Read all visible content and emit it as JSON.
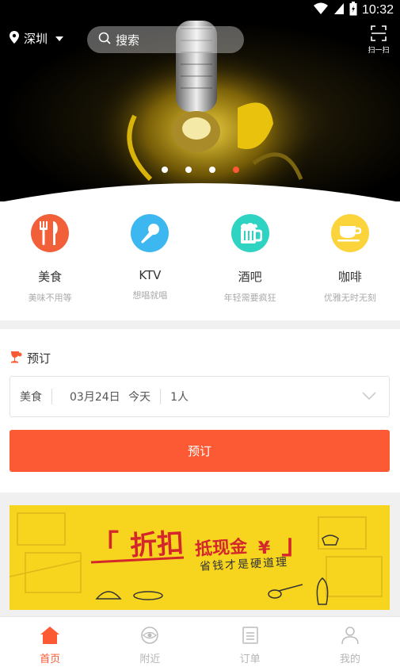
{
  "status_bar": {
    "time": "10:32"
  },
  "header": {
    "city": "深圳",
    "search_placeholder": "搜索",
    "scan_label": "扫一扫"
  },
  "carousel": {
    "count": 4,
    "active_index": 3
  },
  "categories": [
    {
      "title": "美食",
      "subtitle": "美味不用等",
      "color": "#f2603a",
      "icon": "fork-knife-icon"
    },
    {
      "title": "KTV",
      "subtitle": "想唱就唱",
      "color": "#3cb7f0",
      "icon": "microphone-icon"
    },
    {
      "title": "酒吧",
      "subtitle": "年轻需要疯狂",
      "color": "#2ed3c1",
      "icon": "beer-mug-icon"
    },
    {
      "title": "咖啡",
      "subtitle": "优雅无时无刻",
      "color": "#fbd43b",
      "icon": "coffee-cup-icon"
    }
  ],
  "booking": {
    "title": "预订",
    "category": "美食",
    "date": "03月24日",
    "day": "今天",
    "people": "1人",
    "button_label": "预订"
  },
  "promo": {
    "headline_main": "折扣",
    "headline_second": "抵现金",
    "currency_symbol": "¥",
    "tagline": "省钱才是硬道理"
  },
  "bottom_nav": [
    {
      "label": "首页",
      "active": true,
      "icon": "home-icon"
    },
    {
      "label": "附近",
      "active": false,
      "icon": "eye-icon"
    },
    {
      "label": "订单",
      "active": false,
      "icon": "document-icon"
    },
    {
      "label": "我的",
      "active": false,
      "icon": "person-icon"
    }
  ],
  "colors": {
    "accent": "#fb5a34",
    "promo_bg": "#f7d51f",
    "promo_text": "#d3272b"
  }
}
